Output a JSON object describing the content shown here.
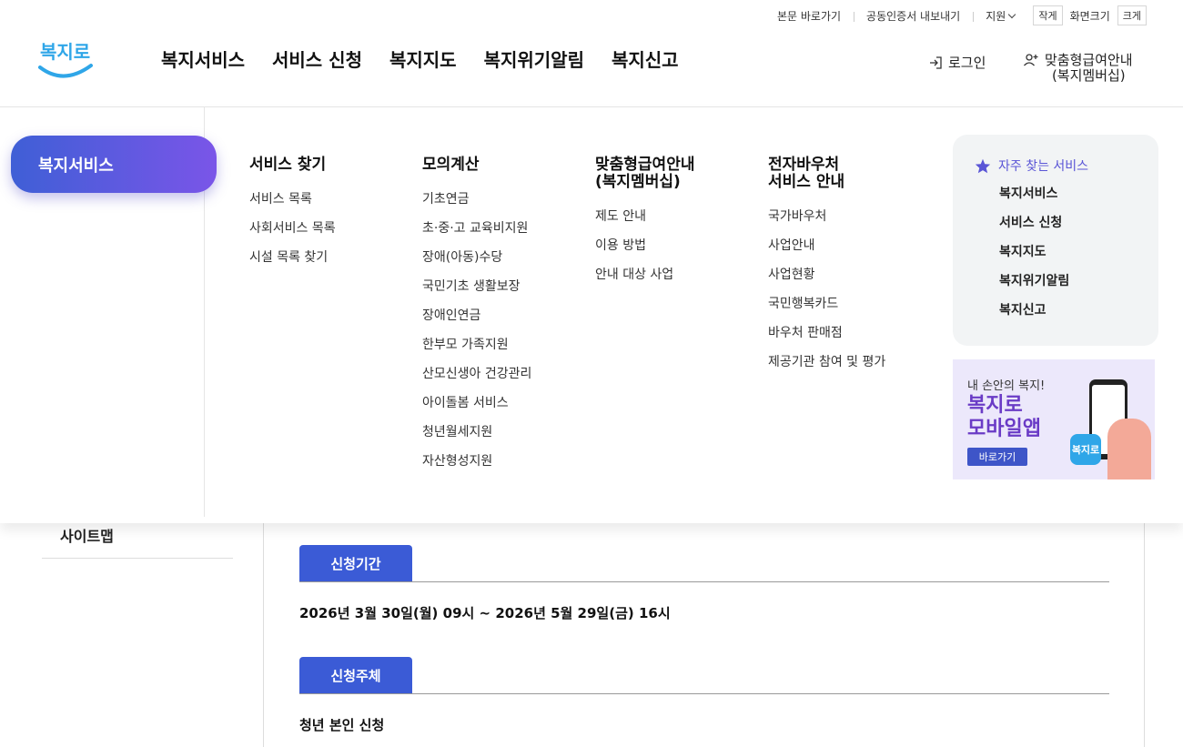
{
  "utility": {
    "skip_to_content": "본문 바로가기",
    "export_cert": "공동인증서 내보내기",
    "support": "지원",
    "size_small": "작게",
    "size_label": "화면크기",
    "size_large": "크게"
  },
  "header": {
    "logo_text": "복지로",
    "nav": [
      "복지서비스",
      "서비스 신청",
      "복지지도",
      "복지위기알림",
      "복지신고"
    ],
    "login": "로그인",
    "member_line1": "맞춤형급여안내",
    "member_line2": "(복지멤버십)"
  },
  "mega_menu": {
    "active_category": "복지서비스",
    "columns": [
      {
        "title_line1": "서비스 찾기",
        "title_line2": "",
        "items": [
          "서비스 목록",
          "사회서비스 목록",
          "시설 목록 찾기"
        ]
      },
      {
        "title_line1": "모의계산",
        "title_line2": "",
        "items": [
          "기초연금",
          "초·중·고 교육비지원",
          "장애(아동)수당",
          "국민기초 생활보장",
          "장애인연금",
          "한부모 가족지원",
          "산모신생아 건강관리",
          "아이돌봄 서비스",
          "청년월세지원",
          "자산형성지원"
        ]
      },
      {
        "title_line1": "맞춤형급여안내",
        "title_line2": "(복지멤버십)",
        "items": [
          "제도 안내",
          "이용 방법",
          "안내 대상 사업"
        ]
      },
      {
        "title_line1": "전자바우처",
        "title_line2": "서비스 안내",
        "items": [
          "국가바우처",
          "사업안내",
          "사업현황",
          "국민행복카드",
          "바우처 판매점",
          "제공기관 참여 및 평가"
        ]
      }
    ],
    "favorites": {
      "title": "자주 찾는 서비스",
      "items": [
        "복지서비스",
        "서비스 신청",
        "복지지도",
        "복지위기알림",
        "복지신고"
      ]
    },
    "banner": {
      "subtitle": "내 손안의 복지!",
      "title_line1": "복지로",
      "title_line2": "모바일앱",
      "button": "바로가기",
      "app_icon_text": "복지로"
    }
  },
  "page": {
    "sidebar_item": "사이트맵",
    "sections": [
      {
        "tab": "신청기간",
        "text": "2026년 3월 30일(월) 09시 ~ 2026년 5월 29일(금) 16시"
      },
      {
        "tab": "신청주체",
        "text": "청년 본인 신청"
      }
    ]
  },
  "colors": {
    "accent": "#3b5bd6",
    "pill_gradient_start": "#3f5fd6",
    "pill_gradient_end": "#7a55e8",
    "favorite_title": "#5a55d6",
    "logo_blue": "#2fa6e8",
    "logo_green": "#7bc143"
  }
}
